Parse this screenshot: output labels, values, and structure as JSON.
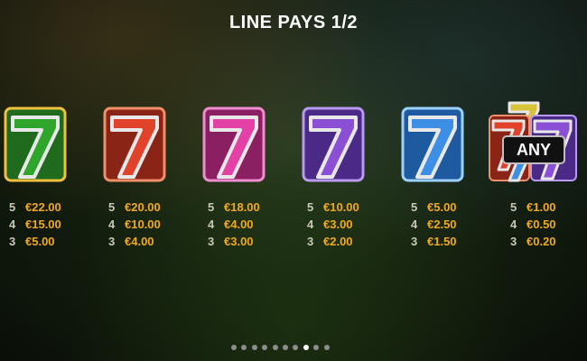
{
  "title": "LINE PAYS 1/2",
  "symbols": [
    {
      "name": "seven-green",
      "color": "#2fa52c",
      "pays": [
        {
          "count": "5",
          "amount": "€22.00"
        },
        {
          "count": "4",
          "amount": "€15.00"
        },
        {
          "count": "3",
          "amount": "€5.00"
        }
      ]
    },
    {
      "name": "seven-red",
      "color": "#e0422a",
      "pays": [
        {
          "count": "5",
          "amount": "€20.00"
        },
        {
          "count": "4",
          "amount": "€10.00"
        },
        {
          "count": "3",
          "amount": "€4.00"
        }
      ]
    },
    {
      "name": "seven-pink",
      "color": "#e441a6",
      "pays": [
        {
          "count": "5",
          "amount": "€18.00"
        },
        {
          "count": "4",
          "amount": "€4.00"
        },
        {
          "count": "3",
          "amount": "€3.00"
        }
      ]
    },
    {
      "name": "seven-purple",
      "color": "#8b4fd6",
      "pays": [
        {
          "count": "5",
          "amount": "€10.00"
        },
        {
          "count": "4",
          "amount": "€3.00"
        },
        {
          "count": "3",
          "amount": "€2.00"
        }
      ]
    },
    {
      "name": "seven-blue",
      "color": "#3d8fe6",
      "pays": [
        {
          "count": "5",
          "amount": "€5.00"
        },
        {
          "count": "4",
          "amount": "€2.50"
        },
        {
          "count": "3",
          "amount": "€1.50"
        }
      ]
    },
    {
      "name": "seven-any",
      "color": "#6f4ccf",
      "label": "ANY",
      "pays": [
        {
          "count": "5",
          "amount": "€1.00"
        },
        {
          "count": "4",
          "amount": "€0.50"
        },
        {
          "count": "3",
          "amount": "€0.20"
        }
      ]
    }
  ],
  "pagination": {
    "total": 10,
    "active": 8
  }
}
